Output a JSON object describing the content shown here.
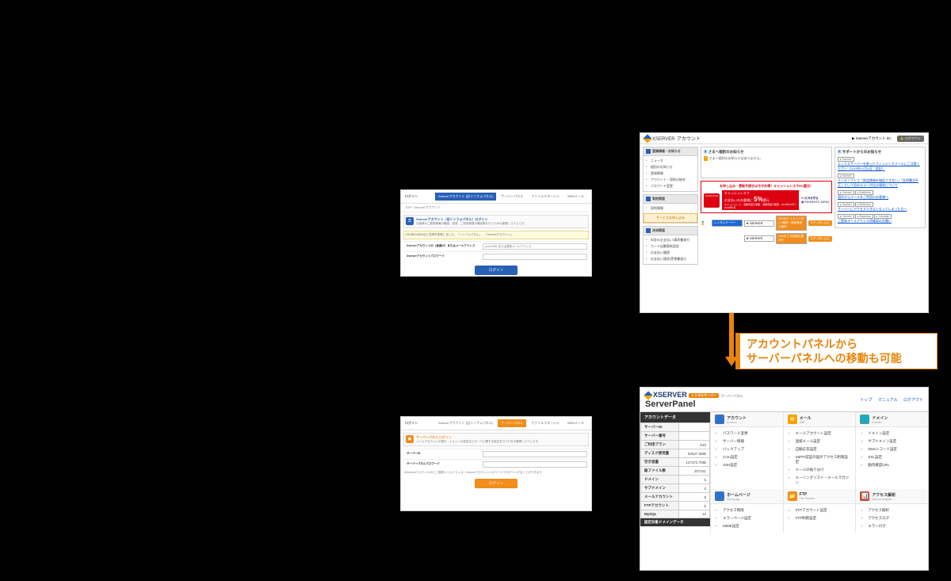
{
  "login_account": {
    "title": "ログイン",
    "tabs": [
      "Xserverアカウント (旧インフォパネル)",
      "サーバーパネル",
      "ファイルマネージャ",
      "WEBメール"
    ],
    "breadcrumb": "TOP › Xserverアカウント",
    "section_title": "Xserverアカウント（旧インフォパネル）ログイン",
    "section_desc": "お客様のご登録情報の確認、変更、ご利用期限の確認等を行うための管理システムです。",
    "notice": "2019年11月28日に名称を変更しました。「インフォパネル」→「Xserverアカウント」",
    "field1_label": "XserverアカウントID（会員ID）またはメールアドレス",
    "field1_placeholder": "pxx12345 または登録メールアドレス",
    "field2_label": "Xserverアカウントパスワード",
    "btn": "ログイン"
  },
  "login_server": {
    "title": "ログイン",
    "tabs": [
      "Xserverアカウント (旧インフォパネル)",
      "サーバーパネル",
      "ファイルマネージャ",
      "WEBメール"
    ],
    "section_title": "サーバーパネル ログイン",
    "section_desc": "メールアカウントの発行・ドメインの設定などサーバに関する設定を行うための管理システムです。",
    "field1_label": "サーバーID",
    "field2_label": "サーバーパネルパスワード",
    "hint": "※XserverアカウントIDとご登録メールアドレス・Xserverアカウントパスワードでログインすることができます",
    "btn": "ログイン"
  },
  "account_panel": {
    "brand": "XSERVER",
    "brand_sub": "アカウント",
    "user_label": "▶ Xserverアカウント ID：",
    "logout": "ログアウト",
    "left": {
      "sec1": {
        "title": "登録情報・お知らせ",
        "items": [
          "ニュース",
          "個別のお知らせ",
          "登録情報",
          "アカウント・契約の統合",
          "パスワード変更"
        ]
      },
      "sec2": {
        "title": "契約関連",
        "items": [
          "契約情報"
        ],
        "svc": "サービスお申し込み"
      },
      "sec3": {
        "title": "決済関連",
        "items": [
          "料金のお支払い/請求書発行",
          "カード自動更新設定",
          "お支払い履歴",
          "お支払い請求/受領書発行"
        ]
      }
    },
    "news": {
      "title": "さまへ個別のお知らせ",
      "item": "さまへ個別のお知らせはありません。"
    },
    "support": {
      "title": "サポートからのお知らせ",
      "links": [
        {
          "cats": [
            "Xserver"
          ],
          "text": "エックスサーバーを装ったフィッシングメールにご注意ください（2019年12月4日　追記）"
        },
        {
          "cats": [
            "Xserver"
          ],
          "text": "メールソフトで「照会情報を検証できない」「証明書が不正」という旨のエラーが出る場合について"
        },
        {
          "cats": [
            "Xserver",
            "Business"
          ],
          "text": "国外からメールをご利用のお客様へ"
        },
        {
          "cats": [
            "Xserver",
            "Business"
          ],
          "text": "サーバーにアクセスできなくなってしまった方へ"
        },
        {
          "cats": [
            "Xserver",
            "Business",
            "Xdomain"
          ],
          "text": "ご登録メールアドレス再確認のお願い"
        }
      ]
    },
    "cashless": {
      "top": "お申し込み・更新手続きは今がお得！キャッシュレスで5%還元！",
      "line1": "キャッシュレスで",
      "line2": "お支払いのお客様に",
      "pct": "5%",
      "ret": "還元",
      "note": "キャッシュレス・消費者還元事業／消費者還元期間：2019年10月〜2020年6月",
      "badge": "CASHLESS",
      "meti": "経済産業省"
    },
    "ads": {
      "row1": {
        "tag": "レンタルサーバー",
        "brand": "XSERVER",
        "promo": "4/30まで ドメインが1つ無料！更新費用も無料！",
        "btn": "今すぐ申し込む"
      },
      "row2": {
        "tag": "",
        "brand": "XSERVER",
        "promo": "4/30まで 初期設定費0円！",
        "btn": "今すぐ申し込む"
      }
    }
  },
  "callout": {
    "line1": "アカウントパネルから",
    "line2": "サーバーパネルへの移動も可能"
  },
  "server_panel": {
    "brand": "XSERVER",
    "brand_tag": "レンタルサーバー",
    "title": "ServerPanel",
    "title_rt": "サーバーパネル",
    "top_links": [
      "トップ",
      "マニュアル",
      "ログアウト"
    ],
    "data": {
      "title": "アカウントデータ",
      "rows": [
        [
          "サーバーID",
          ""
        ],
        [
          "サーバー番号",
          ""
        ],
        [
          "ご利用プラン",
          "X10"
        ],
        [
          "ディスク使用量",
          "52627.3MB"
        ],
        [
          "空き容量",
          "147372.7MB"
        ],
        [
          "総ファイル数",
          "207151"
        ],
        [
          "ドメイン",
          "5"
        ],
        [
          "サブドメイン",
          "0"
        ],
        [
          "メールアカウント",
          "9"
        ],
        [
          "FTPアカウント",
          "5"
        ],
        [
          "MySQL",
          "12"
        ]
      ],
      "dom_target": "設定対象ドメインデータ"
    },
    "cats": [
      {
        "icon": "ci-blue",
        "title": "アカウント",
        "sub": "Account",
        "items": [
          "パスワード変更",
          "サーバー情報",
          "バックアップ",
          "Cron設定",
          "SSH設定"
        ]
      },
      {
        "icon": "ci-yellow",
        "title": "メール",
        "sub": "Mail",
        "items": [
          "メールアカウント設定",
          "迷惑メール設定",
          "自動応答設定",
          "SMTP認証の国外アクセス制限設定",
          "メールの振り分け",
          "メーリングリスト・メールマガジン"
        ]
      },
      {
        "icon": "ci-teal",
        "title": "ドメイン",
        "sub": "Domain",
        "items": [
          "ドメイン設定",
          "サブドメイン設定",
          "DNSレコード設定",
          "SSL設定",
          "動作確認URL"
        ]
      },
      {
        "icon": "ci-blue",
        "title": "ホームページ",
        "sub": "Homepage",
        "items": [
          "アクセス制限",
          "エラーページ設定",
          "MIME設定"
        ]
      },
      {
        "icon": "ci-orange",
        "title": "FTP",
        "sub": "File Transfer",
        "items": [
          "FTPアカウント設定",
          "FTP制限設定"
        ]
      },
      {
        "icon": "ci-red",
        "title": "アクセス解析",
        "sub": "Access analysis",
        "items": [
          "アクセス解析",
          "アクセスログ",
          "エラーログ"
        ]
      }
    ]
  }
}
